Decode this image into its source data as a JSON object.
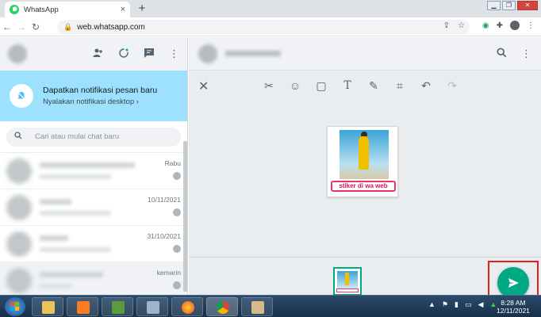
{
  "browser": {
    "tab_title": "WhatsApp",
    "tab_close": "×",
    "new_tab": "+",
    "url": "web.whatsapp.com",
    "window_controls": [
      "▁",
      "❐",
      "✕"
    ]
  },
  "sidebar": {
    "notification": {
      "title": "Dapatkan notifikasi pesan baru",
      "link": "Nyalakan notifikasi desktop ›"
    },
    "search_placeholder": "Cari atau mulai chat baru",
    "chats": [
      {
        "date": "Rabu"
      },
      {
        "date": "10/11/2021"
      },
      {
        "date": "31/10/2021"
      },
      {
        "date": "kemarin"
      }
    ]
  },
  "editor": {
    "sticker_text": "stiker di wa web",
    "tools": [
      "scissors-icon",
      "emoji-icon",
      "sticker-icon",
      "text-icon",
      "pen-icon",
      "crop-icon",
      "undo-icon",
      "redo-icon"
    ]
  },
  "taskbar": {
    "time": "8:28 AM",
    "date": "12/11/2021"
  },
  "colors": {
    "accent": "#00a884",
    "notification_bg": "#9de1fe",
    "highlight": "#e02020"
  }
}
